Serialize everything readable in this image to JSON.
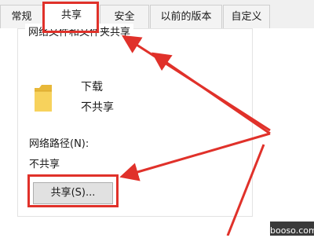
{
  "tabs": [
    {
      "label": "常规"
    },
    {
      "label": "共享",
      "active": true
    },
    {
      "label": "安全"
    },
    {
      "label": "以前的版本"
    },
    {
      "label": "自定义"
    }
  ],
  "group": {
    "title": "网络文件和文件夹共享",
    "folder_name": "下载",
    "folder_status": "不共享",
    "network_path_label": "网络路径(N):",
    "network_path_value": "不共享",
    "share_button_label": "共享(S)..."
  },
  "annotations": {
    "highlight_color": "#e0312a"
  },
  "watermark": {
    "text": "booso.com"
  }
}
